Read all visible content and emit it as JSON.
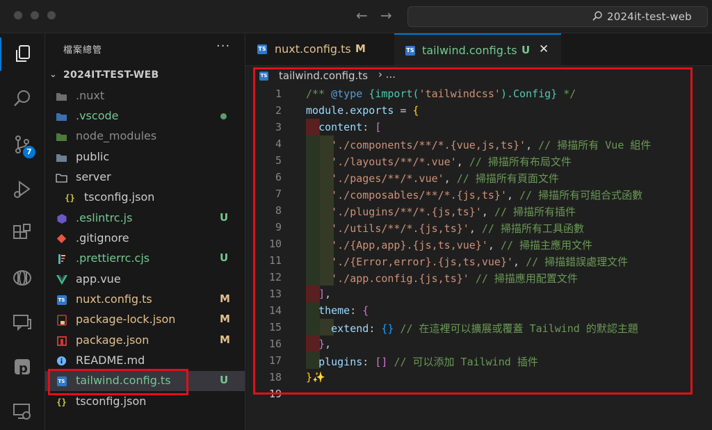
{
  "window": {
    "command_center_text": "2024it-test-web"
  },
  "activity_bar": {
    "source_control_badge": "7",
    "items": [
      "explorer-icon",
      "search-icon",
      "source-control-icon",
      "run-debug-icon",
      "extensions-icon",
      "remote-icon",
      "chat-icon",
      "p-extension-icon",
      "remote-explorer-icon"
    ]
  },
  "sidebar": {
    "title": "檔案總管",
    "more": "···",
    "section_label": "2024IT-TEST-WEB",
    "items": [
      {
        "name": ".nuxt",
        "icon": "folder-icon",
        "color": "#8c8c8c",
        "status": ""
      },
      {
        "name": ".vscode",
        "icon": "vscode-folder-icon",
        "color": "#73c991",
        "status": "dot"
      },
      {
        "name": "node_modules",
        "icon": "node-folder-icon",
        "color": "#8c8c8c",
        "status": ""
      },
      {
        "name": "public",
        "icon": "public-folder-icon",
        "color": "#cccccc",
        "status": ""
      },
      {
        "name": "server",
        "icon": "folder-icon",
        "color": "#cccccc",
        "status": ""
      },
      {
        "name": "tsconfig.json",
        "icon": "json-braces-icon",
        "color": "#cccccc",
        "status": ""
      },
      {
        "name": ".eslintrc.js",
        "icon": "eslint-icon",
        "color": "#73c991",
        "status": "U"
      },
      {
        "name": ".gitignore",
        "icon": "git-icon",
        "color": "#cccccc",
        "status": ""
      },
      {
        "name": ".prettierrc.cjs",
        "icon": "prettier-icon",
        "color": "#73c991",
        "status": "U"
      },
      {
        "name": "app.vue",
        "icon": "vue-icon",
        "color": "#cccccc",
        "status": ""
      },
      {
        "name": "nuxt.config.ts",
        "icon": "ts-icon",
        "color": "#e2c08d",
        "status": "M"
      },
      {
        "name": "package-lock.json",
        "icon": "lock-json-icon",
        "color": "#e2c08d",
        "status": "M"
      },
      {
        "name": "package.json",
        "icon": "npm-icon",
        "color": "#e2c08d",
        "status": "M"
      },
      {
        "name": "README.md",
        "icon": "info-icon",
        "color": "#cccccc",
        "status": ""
      },
      {
        "name": "tailwind.config.ts",
        "icon": "ts-icon",
        "color": "#73c991",
        "status": "U"
      },
      {
        "name": "tsconfig.json",
        "icon": "json-braces-icon",
        "color": "#cccccc",
        "status": ""
      }
    ]
  },
  "tabs": [
    {
      "name": "nuxt.config.ts",
      "status": "M",
      "icon": "ts-icon",
      "icon_label": "TS"
    },
    {
      "name": "tailwind.config.ts",
      "status": "U",
      "icon": "ts-icon",
      "icon_label": "TS",
      "close": "✕"
    }
  ],
  "breadcrumb": {
    "file": "tailwind.config.ts",
    "sep": "› ..."
  },
  "editor": {
    "line_numbers": [
      "1",
      "2",
      "3",
      "4",
      "5",
      "6",
      "7",
      "8",
      "9",
      "10",
      "11",
      "12",
      "13",
      "14",
      "15",
      "16",
      "17",
      "18",
      "19"
    ],
    "lines": [
      "/** @type {import('tailwindcss').Config} */",
      "module.exports = {",
      "  content: [",
      "    './components/**/*.{vue,js,ts}', // 掃描所有 Vue 組件",
      "    './layouts/**/*.vue', // 掃描所有布局文件",
      "    './pages/**/*.vue', // 掃描所有頁面文件",
      "    './composables/**/*.{js,ts}', // 掃描所有可組合式函數",
      "    './plugins/**/*.{js,ts}', // 掃描所有插件",
      "    './utils/**/*.{js,ts}', // 掃描所有工具函數",
      "    './{App,app}.{js,ts,vue}', // 掃描主應用文件",
      "    './{Error,error}.{js,ts,vue}', // 掃描錯誤處理文件",
      "    './app.config.{js,ts}' // 掃描應用配置文件",
      "  ],",
      "  theme: {",
      "    extend: {} // 在這裡可以擴展或覆蓋 Tailwind 的默認主題",
      "  },",
      "  plugins: [] // 可以添加 Tailwind 插件",
      "}✨",
      ""
    ]
  },
  "colors": {
    "accent": "#0078d4",
    "annotation_red": "#e0101a",
    "modified": "#e2c08d",
    "untracked": "#73c991"
  }
}
